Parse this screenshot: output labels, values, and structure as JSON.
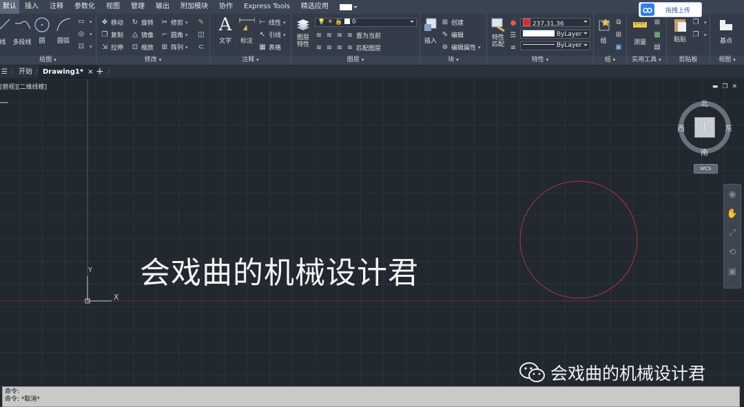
{
  "menu": {
    "tabs": [
      "默认",
      "插入",
      "注释",
      "参数化",
      "视图",
      "管理",
      "输出",
      "附加模块",
      "协作",
      "Express Tools",
      "精选应用"
    ],
    "active_index": 0
  },
  "upload": {
    "label": "拖拽上传",
    "icon": "baidu-cloud-icon"
  },
  "ribbon": {
    "draw": {
      "title": "绘图",
      "line": "线",
      "polyline": "多段线",
      "circle": "圆",
      "arc": "圆弧"
    },
    "modify": {
      "title": "修改",
      "move": "移动",
      "rotate": "旋转",
      "trim": "修剪",
      "copy": "复制",
      "mirror": "镜像",
      "fillet": "圆角",
      "stretch": "拉伸",
      "scale": "缩放",
      "array": "阵列"
    },
    "annotation": {
      "title": "注释",
      "text": "文字",
      "dimension": "标注",
      "linear": "线性",
      "leader": "引线",
      "table": "表格"
    },
    "layers": {
      "title": "图层",
      "properties_line1": "图层",
      "properties_line2": "特性",
      "current_layer": "0",
      "set_current": "置为当前",
      "match_layer": "匹配图层"
    },
    "block": {
      "title": "块",
      "insert": "插入",
      "create": "创建",
      "edit": "编辑",
      "edit_attributes": "编辑属性"
    },
    "properties": {
      "title": "特性",
      "match_line1": "特性",
      "match_line2": "匹配",
      "color": "237,31,36",
      "color_hex": "#ed1f24",
      "linetype": "ByLayer",
      "lineweight": "ByLayer"
    },
    "groups": {
      "title": "组",
      "group": "组"
    },
    "utilities": {
      "title": "实用工具",
      "measure": "测量"
    },
    "clipboard": {
      "title": "剪贴板",
      "paste": "粘贴"
    },
    "view": {
      "title": "视图",
      "base": "基点"
    }
  },
  "filetabs": {
    "start": "开始",
    "drawing": "Drawing1*"
  },
  "viewport": {
    "label": "[俯视][二维线框]"
  },
  "viewcube": {
    "north": "北",
    "south": "南",
    "east": "东",
    "west": "西",
    "top": "上",
    "wcs": "WCS"
  },
  "ucs": {
    "x": "X",
    "y": "Y"
  },
  "drawing_text": "会戏曲的机械设计君",
  "watermark": "会戏曲的机械设计君",
  "command": {
    "line1": "命令:",
    "line2": "命令: *取消*"
  },
  "colors": {
    "circle": "#b1353a",
    "xaxis": "#7a2b33",
    "yaxis": "#2d6a36"
  }
}
